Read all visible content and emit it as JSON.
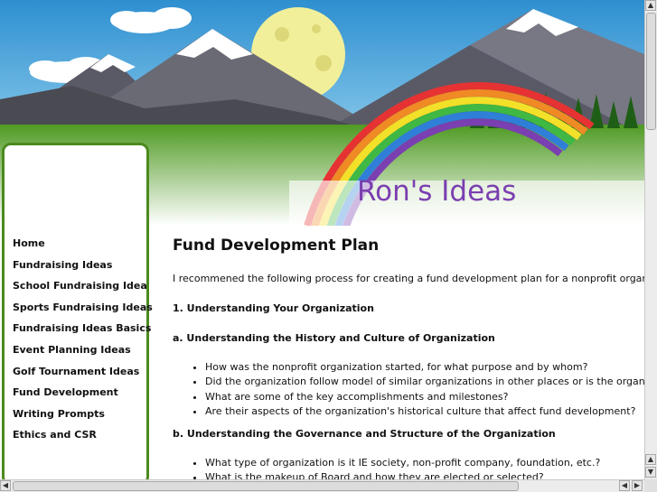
{
  "site": {
    "title": "Ron's Ideas"
  },
  "nav": {
    "items": [
      {
        "label": "Home"
      },
      {
        "label": "Fundraising Ideas"
      },
      {
        "label": "School Fundraising Idea"
      },
      {
        "label": "Sports Fundraising Ideas"
      },
      {
        "label": "Fundraising Ideas Basics"
      },
      {
        "label": "Event Planning Ideas"
      },
      {
        "label": "Golf Tournament Ideas"
      },
      {
        "label": "Fund Development"
      },
      {
        "label": "Writing Prompts"
      },
      {
        "label": "Ethics and CSR"
      }
    ]
  },
  "article": {
    "title": "Fund Development Plan",
    "intro": "I recommened the following process for creating a fund development plan for a nonprofit organization:",
    "section1": "1. Understanding Your Organization",
    "subsection_a": "a. Understanding the History and Culture of Organization",
    "bullets_a": [
      "How was the nonprofit organization started, for what purpose and by whom?",
      "Did the organization follow model of similar organizations in other places or is the organization the",
      "What are some of the key accomplishments and milestones?",
      "Are their aspects of the organization's historical culture that affect fund development?"
    ],
    "subsection_b": "b. Understanding the Governance and Structure of the Organization",
    "bullets_b": [
      "What type of organization is it IE society, non-profit company, foundation, etc.?",
      "What is the makeup of Board and how they are elected or selected?"
    ]
  },
  "colors": {
    "title": "#7a3fb0",
    "sidebar_border": "#4c8a1e",
    "sky": "#3c9dd8"
  }
}
